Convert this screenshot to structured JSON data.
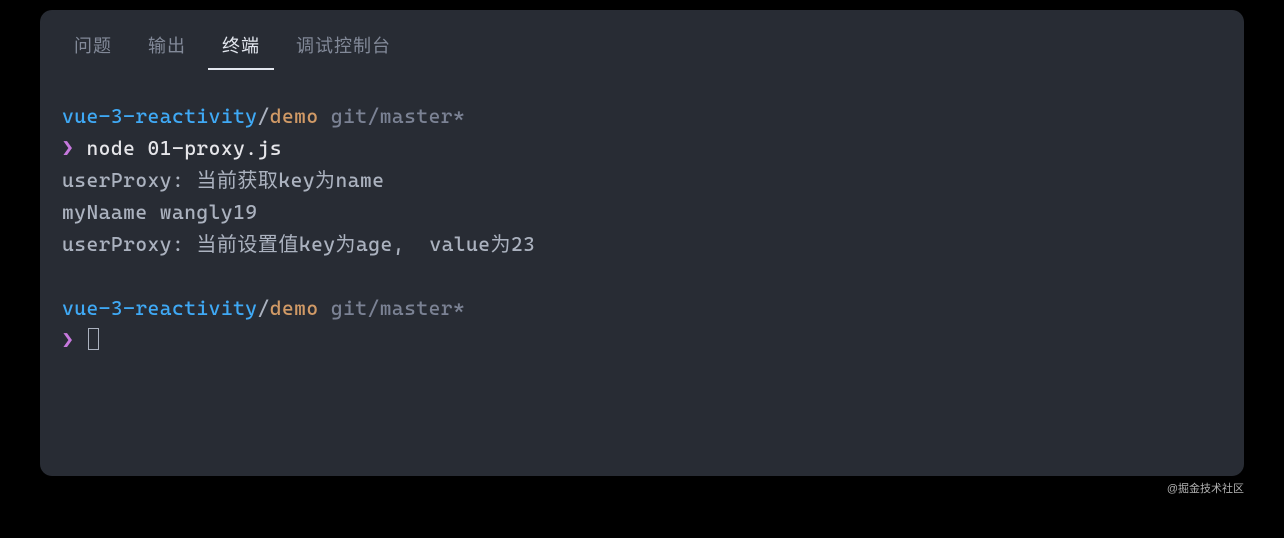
{
  "tabs": {
    "problems": "问题",
    "output": "输出",
    "terminal": "终端",
    "debug": "调试控制台"
  },
  "prompt1": {
    "repo": "vue-3-reactivity",
    "slash": "/",
    "dir": "demo",
    "branch": " git/master*",
    "symbol": "❯",
    "command": " node 01-proxy.js"
  },
  "output": {
    "line1": "userProxy: 当前获取key为name",
    "line2": "myNaame wangly19",
    "line3": "userProxy: 当前设置值key为age,  value为23"
  },
  "prompt2": {
    "repo": "vue-3-reactivity",
    "slash": "/",
    "dir": "demo",
    "branch": " git/master*",
    "symbol": "❯"
  },
  "watermark": "@掘金技术社区"
}
